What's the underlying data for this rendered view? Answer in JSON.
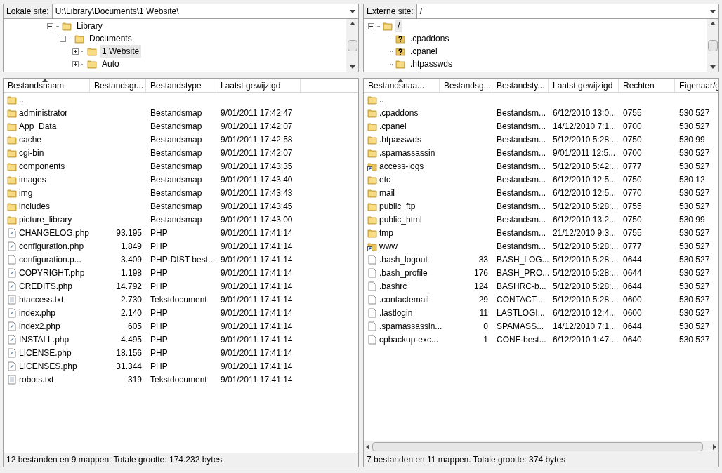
{
  "local": {
    "site_label": "Lokale site:",
    "path": "U:\\Library\\Documents\\1 Website\\",
    "tree": [
      {
        "label": "Library",
        "kind": "folder",
        "expanded": true,
        "selected": false,
        "children": [
          {
            "label": "Documents",
            "kind": "folder",
            "expanded": true,
            "selected": false,
            "children": [
              {
                "label": "1 Website",
                "kind": "folder",
                "expanded": false,
                "selected": true
              },
              {
                "label": "Auto",
                "kind": "folder",
                "expanded": false,
                "selected": false
              }
            ]
          }
        ]
      }
    ],
    "columns": [
      {
        "label": "Bestandsnaam",
        "sorted": true
      },
      {
        "label": "Bestandsgr...",
        "sorted": false
      },
      {
        "label": "Bestandstype",
        "sorted": false
      },
      {
        "label": "Laatst gewijzigd",
        "sorted": false
      }
    ],
    "rows": [
      {
        "kind": "folder",
        "cells": [
          "..",
          "",
          "",
          ""
        ]
      },
      {
        "kind": "folder",
        "cells": [
          "administrator",
          "",
          "Bestandsmap",
          "9/01/2011 17:42:47"
        ]
      },
      {
        "kind": "folder",
        "cells": [
          "App_Data",
          "",
          "Bestandsmap",
          "9/01/2011 17:42:07"
        ]
      },
      {
        "kind": "folder",
        "cells": [
          "cache",
          "",
          "Bestandsmap",
          "9/01/2011 17:42:58"
        ]
      },
      {
        "kind": "folder",
        "cells": [
          "cgi-bin",
          "",
          "Bestandsmap",
          "9/01/2011 17:42:07"
        ]
      },
      {
        "kind": "folder",
        "cells": [
          "components",
          "",
          "Bestandsmap",
          "9/01/2011 17:43:35"
        ]
      },
      {
        "kind": "folder",
        "cells": [
          "images",
          "",
          "Bestandsmap",
          "9/01/2011 17:43:40"
        ]
      },
      {
        "kind": "folder",
        "cells": [
          "img",
          "",
          "Bestandsmap",
          "9/01/2011 17:43:43"
        ]
      },
      {
        "kind": "folder",
        "cells": [
          "includes",
          "",
          "Bestandsmap",
          "9/01/2011 17:43:45"
        ]
      },
      {
        "kind": "folder",
        "cells": [
          "picture_library",
          "",
          "Bestandsmap",
          "9/01/2011 17:43:00"
        ]
      },
      {
        "kind": "script",
        "cells": [
          "CHANGELOG.php",
          "93.195",
          "PHP",
          "9/01/2011 17:41:14"
        ]
      },
      {
        "kind": "script",
        "cells": [
          "configuration.php",
          "1.849",
          "PHP",
          "9/01/2011 17:41:14"
        ]
      },
      {
        "kind": "file",
        "cells": [
          "configuration.p...",
          "3.409",
          "PHP-DIST-best...",
          "9/01/2011 17:41:14"
        ]
      },
      {
        "kind": "script",
        "cells": [
          "COPYRIGHT.php",
          "1.198",
          "PHP",
          "9/01/2011 17:41:14"
        ]
      },
      {
        "kind": "script",
        "cells": [
          "CREDITS.php",
          "14.792",
          "PHP",
          "9/01/2011 17:41:14"
        ]
      },
      {
        "kind": "text",
        "cells": [
          "htaccess.txt",
          "2.730",
          "Tekstdocument",
          "9/01/2011 17:41:14"
        ]
      },
      {
        "kind": "script",
        "cells": [
          "index.php",
          "2.140",
          "PHP",
          "9/01/2011 17:41:14"
        ]
      },
      {
        "kind": "script",
        "cells": [
          "index2.php",
          "605",
          "PHP",
          "9/01/2011 17:41:14"
        ]
      },
      {
        "kind": "script",
        "cells": [
          "INSTALL.php",
          "4.495",
          "PHP",
          "9/01/2011 17:41:14"
        ]
      },
      {
        "kind": "script",
        "cells": [
          "LICENSE.php",
          "18.156",
          "PHP",
          "9/01/2011 17:41:14"
        ]
      },
      {
        "kind": "script",
        "cells": [
          "LICENSES.php",
          "31.344",
          "PHP",
          "9/01/2011 17:41:14"
        ]
      },
      {
        "kind": "text",
        "cells": [
          "robots.txt",
          "319",
          "Tekstdocument",
          "9/01/2011 17:41:14"
        ]
      }
    ],
    "status": "12 bestanden en 9 mappen. Totale grootte: 174.232 bytes"
  },
  "remote": {
    "site_label": "Externe site:",
    "path": "/",
    "tree": [
      {
        "label": "/",
        "kind": "folder",
        "expanded": true,
        "selected": true,
        "children": [
          {
            "label": ".cpaddons",
            "kind": "unknown",
            "selected": false
          },
          {
            "label": ".cpanel",
            "kind": "unknown",
            "selected": false
          },
          {
            "label": ".htpasswds",
            "kind": "folder",
            "selected": false
          }
        ]
      }
    ],
    "columns": [
      {
        "label": "Bestandsnaa...",
        "sorted": true
      },
      {
        "label": "Bestandsg...",
        "sorted": false
      },
      {
        "label": "Bestandsty...",
        "sorted": false
      },
      {
        "label": "Laatst gewijzigd",
        "sorted": false
      },
      {
        "label": "Rechten",
        "sorted": false
      },
      {
        "label": "Eigenaar/g",
        "sorted": false
      }
    ],
    "rows": [
      {
        "kind": "folder",
        "cells": [
          "..",
          "",
          "",
          "",
          "",
          ""
        ]
      },
      {
        "kind": "folder",
        "cells": [
          ".cpaddons",
          "",
          "Bestandsm...",
          "6/12/2010 13:0...",
          "0755",
          "530 527"
        ]
      },
      {
        "kind": "folder",
        "cells": [
          ".cpanel",
          "",
          "Bestandsm...",
          "14/12/2010 7:1...",
          "0700",
          "530 527"
        ]
      },
      {
        "kind": "folder",
        "cells": [
          ".htpasswds",
          "",
          "Bestandsm...",
          "5/12/2010 5:28:...",
          "0750",
          "530 99"
        ]
      },
      {
        "kind": "folder",
        "cells": [
          ".spamassassin",
          "",
          "Bestandsm...",
          "9/01/2011 12:5...",
          "0700",
          "530 527"
        ]
      },
      {
        "kind": "link",
        "cells": [
          "access-logs",
          "",
          "Bestandsm...",
          "5/12/2010 5:42:...",
          "0777",
          "530 527"
        ]
      },
      {
        "kind": "folder",
        "cells": [
          "etc",
          "",
          "Bestandsm...",
          "6/12/2010 12:5...",
          "0750",
          "530 12"
        ]
      },
      {
        "kind": "folder",
        "cells": [
          "mail",
          "",
          "Bestandsm...",
          "6/12/2010 12:5...",
          "0770",
          "530 527"
        ]
      },
      {
        "kind": "folder",
        "cells": [
          "public_ftp",
          "",
          "Bestandsm...",
          "5/12/2010 5:28:...",
          "0755",
          "530 527"
        ]
      },
      {
        "kind": "folder",
        "cells": [
          "public_html",
          "",
          "Bestandsm...",
          "6/12/2010 13:2...",
          "0750",
          "530 99"
        ]
      },
      {
        "kind": "folder",
        "cells": [
          "tmp",
          "",
          "Bestandsm...",
          "21/12/2010 9:3...",
          "0755",
          "530 527"
        ]
      },
      {
        "kind": "link",
        "cells": [
          "www",
          "",
          "Bestandsm...",
          "5/12/2010 5:28:...",
          "0777",
          "530 527"
        ]
      },
      {
        "kind": "file",
        "cells": [
          ".bash_logout",
          "33",
          "BASH_LOG...",
          "5/12/2010 5:28:...",
          "0644",
          "530 527"
        ]
      },
      {
        "kind": "file",
        "cells": [
          ".bash_profile",
          "176",
          "BASH_PRO...",
          "5/12/2010 5:28:...",
          "0644",
          "530 527"
        ]
      },
      {
        "kind": "file",
        "cells": [
          ".bashrc",
          "124",
          "BASHRC-b...",
          "5/12/2010 5:28:...",
          "0644",
          "530 527"
        ]
      },
      {
        "kind": "file",
        "cells": [
          ".contactemail",
          "29",
          "CONTACT...",
          "5/12/2010 5:28:...",
          "0600",
          "530 527"
        ]
      },
      {
        "kind": "file",
        "cells": [
          ".lastlogin",
          "11",
          "LASTLOGI...",
          "6/12/2010 12:4...",
          "0600",
          "530 527"
        ]
      },
      {
        "kind": "file",
        "cells": [
          ".spamassassin...",
          "0",
          "SPAMASS...",
          "14/12/2010 7:1...",
          "0644",
          "530 527"
        ]
      },
      {
        "kind": "file",
        "cells": [
          "cpbackup-exc...",
          "1",
          "CONF-best...",
          "6/12/2010 1:47:...",
          "0640",
          "530 527"
        ]
      }
    ],
    "status": "7 bestanden en 11 mappen. Totale grootte: 374 bytes"
  }
}
